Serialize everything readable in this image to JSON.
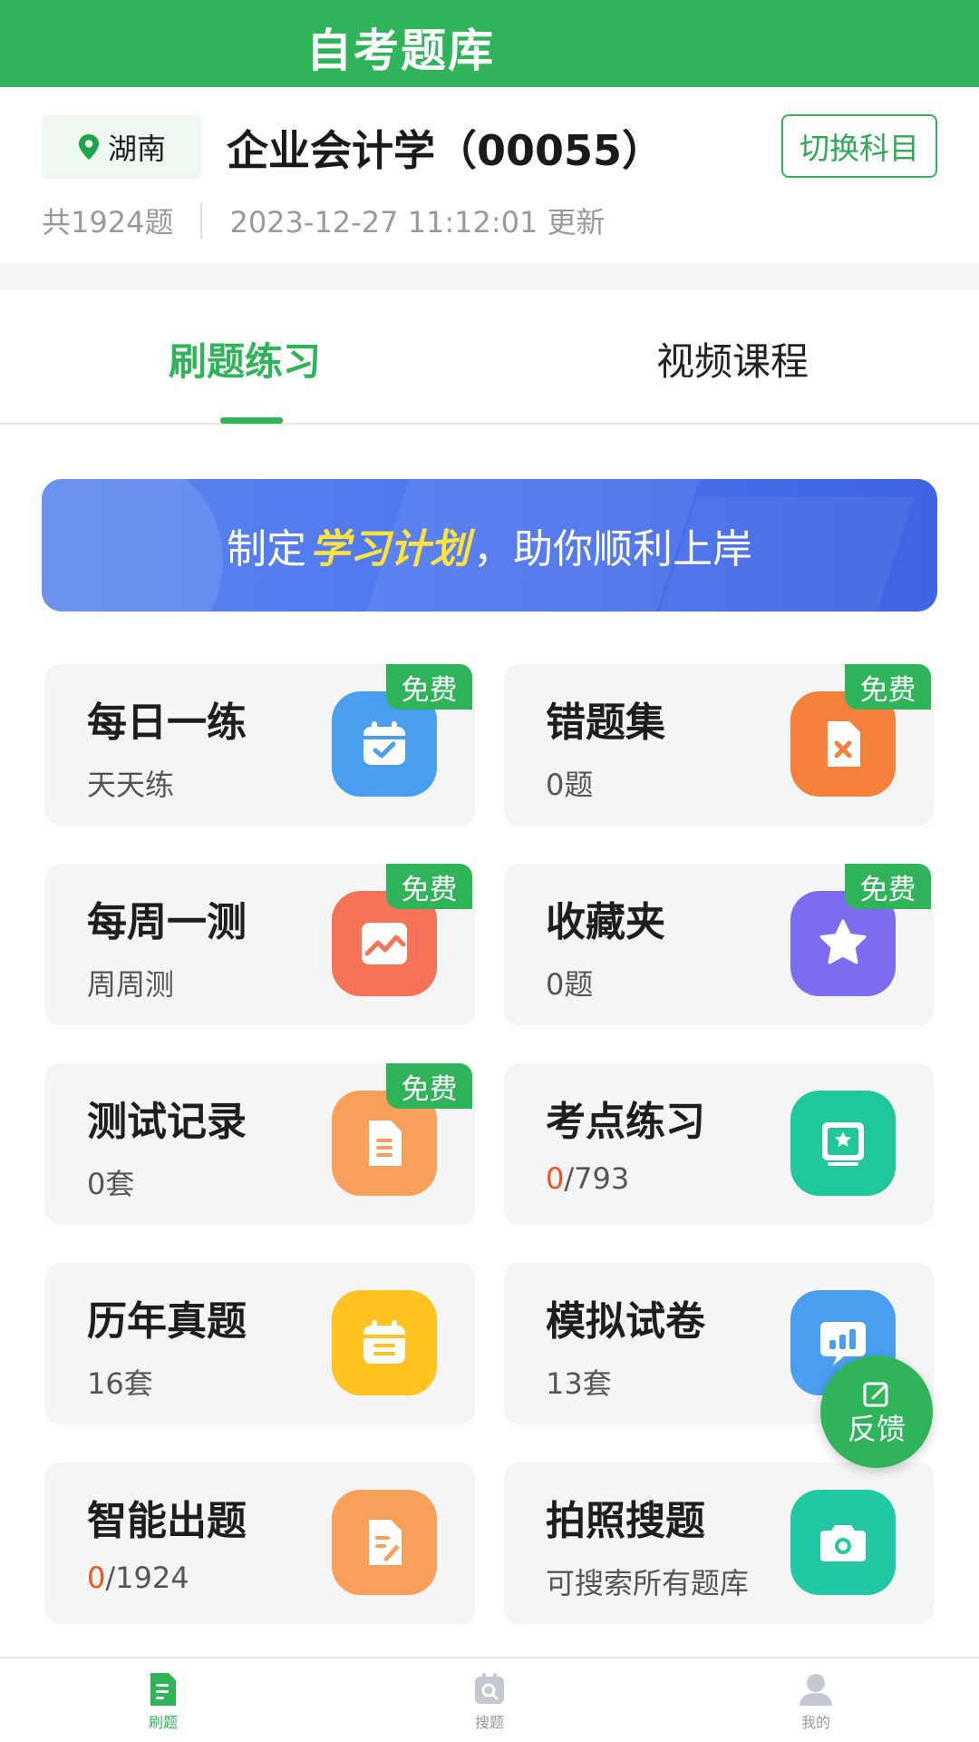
{
  "header": {
    "title": "自考题库"
  },
  "subject_info": {
    "region": "湖南",
    "subject_name": "企业会计学（00055）",
    "switch_label": "切换科目",
    "question_count": "共1924题",
    "updated": "2023-12-27 11:12:01 更新"
  },
  "tabs": [
    {
      "label": "刷题练习",
      "active": true
    },
    {
      "label": "视频课程",
      "active": false
    }
  ],
  "banner": {
    "prefix": "制定",
    "highlight": "学习计划",
    "suffix": "，助你顺利上岸"
  },
  "free_badge": "免费",
  "cards": [
    {
      "title": "每日一练",
      "subtitle": "天天练",
      "icon": "calendar-check-icon",
      "color": "#4a9ef0",
      "free": true
    },
    {
      "title": "错题集",
      "subtitle": "0题",
      "icon": "wrong-doc-icon",
      "color": "#f5803b",
      "free": true
    },
    {
      "title": "每周一测",
      "subtitle": "周周测",
      "icon": "chart-line-icon",
      "color": "#f77358",
      "free": true
    },
    {
      "title": "收藏夹",
      "subtitle": "0题",
      "icon": "star-icon",
      "color": "#7b6cf0",
      "free": true
    },
    {
      "title": "测试记录",
      "subtitle": "0套",
      "icon": "document-icon",
      "color": "#f7a05a",
      "free": true
    },
    {
      "title": "考点练习",
      "progress_done": "0",
      "progress_total": "/793",
      "icon": "star-board-icon",
      "color": "#1fc79a",
      "free": false
    },
    {
      "title": "历年真题",
      "subtitle": "16套",
      "icon": "exam-calendar-icon",
      "color": "#ffc21e",
      "free": false
    },
    {
      "title": "模拟试卷",
      "subtitle": "13套",
      "icon": "bar-chart-icon",
      "color": "#4a9ef0",
      "free": false
    },
    {
      "title": "智能出题",
      "progress_done": "0",
      "progress_total": "/1924",
      "icon": "edit-doc-icon",
      "color": "#f7a05a",
      "free": false
    },
    {
      "title": "拍照搜题",
      "subtitle": "可搜索所有题库",
      "icon": "camera-icon",
      "color": "#22c8a4",
      "free": false
    }
  ],
  "feedback": {
    "label": "反馈"
  },
  "bottom_nav": [
    {
      "label": "刷题",
      "active": true
    },
    {
      "label": "搜题",
      "active": false
    },
    {
      "label": "我的",
      "active": false
    }
  ]
}
